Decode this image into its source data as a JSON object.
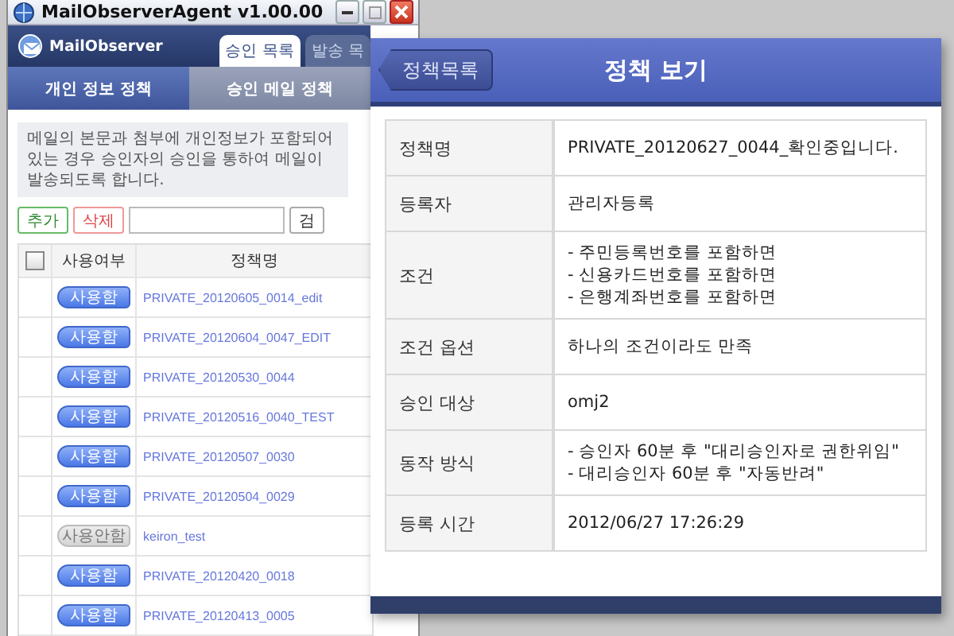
{
  "window": {
    "title": "MailObserverAgent v1.00.00"
  },
  "app": {
    "logo": "MailObserver"
  },
  "tabs": [
    {
      "label": "승인 목록",
      "selected": true
    },
    {
      "label": "발송 목",
      "selected": false
    }
  ],
  "subtabs": [
    {
      "label": "개인 정보 정책",
      "selected": true
    },
    {
      "label": "승인 메일 정책",
      "selected": false
    }
  ],
  "description": "메일의 본문과 첨부에 개인정보가 포함되어 있는 경우 승인자의 승인을 통하여 메일이 발송되도록 합니다.",
  "toolbar": {
    "add": "추가",
    "delete": "삭제",
    "search_button": "검"
  },
  "table": {
    "columns": [
      "사용여부",
      "정책명"
    ],
    "header_checked": false,
    "rows": [
      {
        "status": "사용함",
        "enabled": true,
        "name": "PRIVATE_20120605_0014_edit"
      },
      {
        "status": "사용함",
        "enabled": true,
        "name": "PRIVATE_20120604_0047_EDIT"
      },
      {
        "status": "사용함",
        "enabled": true,
        "name": "PRIVATE_20120530_0044"
      },
      {
        "status": "사용함",
        "enabled": true,
        "name": "PRIVATE_20120516_0040_TEST"
      },
      {
        "status": "사용함",
        "enabled": true,
        "name": "PRIVATE_20120507_0030"
      },
      {
        "status": "사용함",
        "enabled": true,
        "name": "PRIVATE_20120504_0029"
      },
      {
        "status": "사용안함",
        "enabled": false,
        "name": "keiron_test"
      },
      {
        "status": "사용함",
        "enabled": true,
        "name": "PRIVATE_20120420_0018"
      },
      {
        "status": "사용함",
        "enabled": true,
        "name": "PRIVATE_20120413_0005"
      }
    ]
  },
  "detail": {
    "back": "정책목록",
    "title": "정책 보기",
    "fields": [
      {
        "label": "정책명",
        "lines": [
          "PRIVATE_20120627_0044_확인중입니다."
        ]
      },
      {
        "label": "등록자",
        "lines": [
          "관리자등록"
        ]
      },
      {
        "label": "조건",
        "lines": [
          "- 주민등록번호를 포함하면",
          "- 신용카드번호를 포함하면",
          "- 은행계좌번호를 포함하면"
        ]
      },
      {
        "label": "조건 옵션",
        "lines": [
          "하나의 조건이라도 만족"
        ]
      },
      {
        "label": "승인 대상",
        "lines": [
          "omj2"
        ]
      },
      {
        "label": "동작 방식",
        "lines": [
          "- 승인자 60분 후 \"대리승인자로 권한위임\"",
          "- 대리승인자 60분 후 \"자동반려\""
        ]
      },
      {
        "label": "등록 시간",
        "lines": [
          "2012/06/27 17:26:29"
        ]
      }
    ]
  }
}
